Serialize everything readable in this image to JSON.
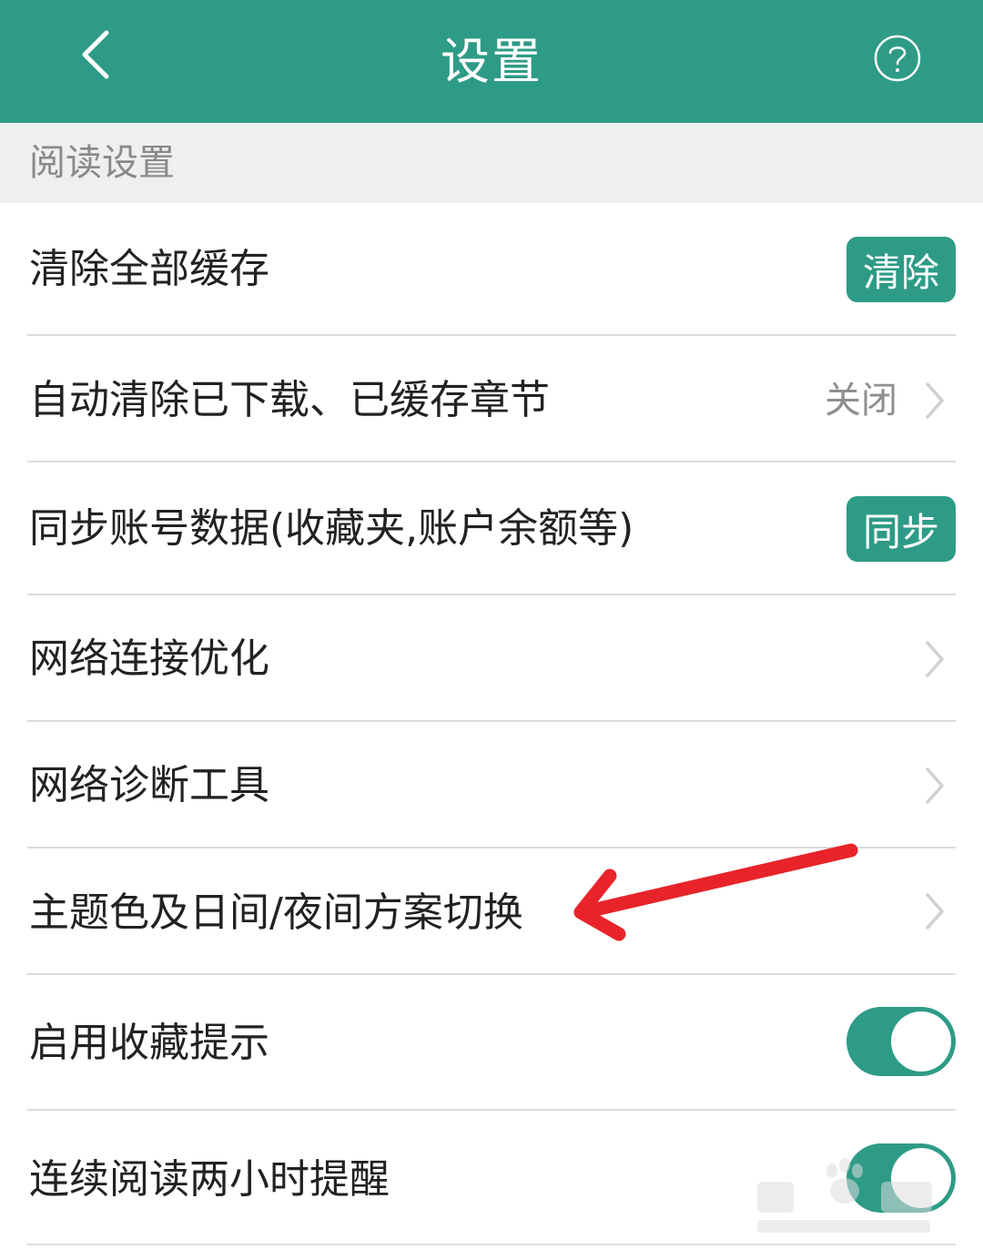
{
  "colors": {
    "accent": "#2e9b87",
    "section_bg": "#efefef",
    "annotation": "#e8242a"
  },
  "header": {
    "title": "设置",
    "back_icon": "chevron-left-icon",
    "help_icon": "help-circle-icon"
  },
  "section": {
    "title": "阅读设置"
  },
  "rows": [
    {
      "label": "清除全部缓存",
      "control": "button",
      "button_label": "清除"
    },
    {
      "label": "自动清除已下载、已缓存章节",
      "control": "value-chevron",
      "value": "关闭"
    },
    {
      "label": "同步账号数据(收藏夹,账户余额等)",
      "control": "button",
      "button_label": "同步"
    },
    {
      "label": "网络连接优化",
      "control": "chevron"
    },
    {
      "label": "网络诊断工具",
      "control": "chevron"
    },
    {
      "label": "主题色及日间/夜间方案切换",
      "control": "chevron"
    },
    {
      "label": "启用收藏提示",
      "control": "toggle",
      "toggle_on": true
    },
    {
      "label": "连续阅读两小时提醒",
      "control": "toggle",
      "toggle_on": true
    }
  ]
}
